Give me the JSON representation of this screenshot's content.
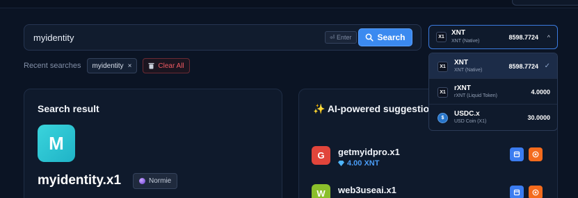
{
  "search": {
    "value": "myidentity",
    "enter_hint": "⏎ Enter",
    "button_label": "Search"
  },
  "recent": {
    "label": "Recent searches",
    "items": [
      {
        "label": "myidentity",
        "remove": "×"
      }
    ],
    "clear_label": "Clear All"
  },
  "result": {
    "title": "Search result",
    "avatar_letter": "M",
    "domain": "myidentity.x1",
    "tier_label": "Normie"
  },
  "ai": {
    "title_icon": "✨",
    "title": "AI-powered suggestions",
    "suggestions": [
      {
        "letter": "G",
        "name": "getmyidpro.x1",
        "price": "4.00 XNT",
        "avatar_color": "#e1453b"
      },
      {
        "letter": "W",
        "name": "web3useai.x1",
        "price": "",
        "avatar_color": "#8bbf2b"
      }
    ]
  },
  "token_select": {
    "selected": {
      "icon": "X1",
      "symbol": "XNT",
      "name": "XNT (Native)",
      "balance": "8598.7724"
    },
    "chevron": "^"
  },
  "token_options": [
    {
      "icon": "X1",
      "symbol": "XNT",
      "name": "XNT (Native)",
      "balance": "8598.7724",
      "selected": true,
      "check": "✓"
    },
    {
      "icon": "X1",
      "symbol": "rXNT",
      "name": "rXNT (Liquid Token)",
      "balance": "4.0000",
      "selected": false,
      "check": ""
    },
    {
      "icon": "$",
      "symbol": "USDC.x",
      "name": "USD Coin (X1)",
      "balance": "30.0000",
      "selected": false,
      "check": ""
    }
  ],
  "colors": {
    "accent": "#3b8af0",
    "danger": "#f05a62",
    "price": "#4a9cf5",
    "cart_button": "#3b7cf0",
    "action_button": "#f46b1d"
  }
}
